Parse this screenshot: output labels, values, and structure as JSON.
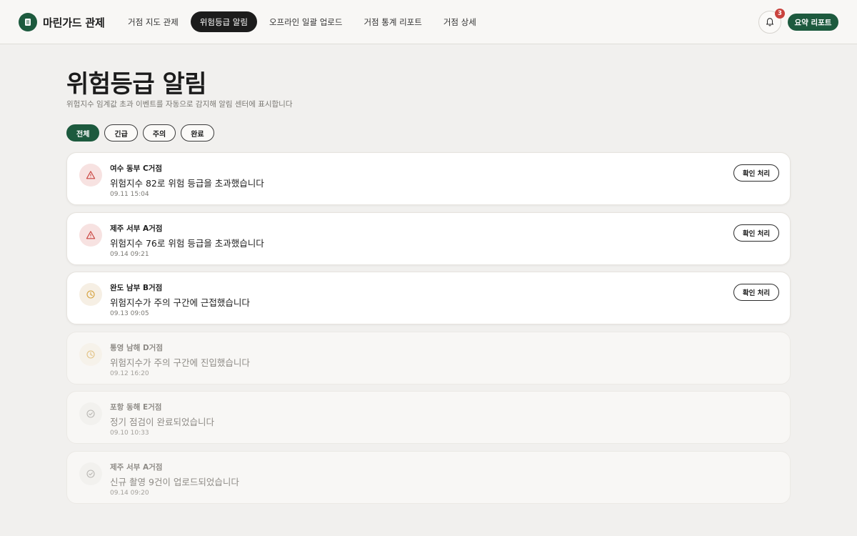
{
  "brand": {
    "name": "마린가드 관제",
    "icon": "document-icon"
  },
  "nav": {
    "tabs": [
      {
        "label": "거점 지도 관제",
        "active": false
      },
      {
        "label": "위험등급 알림",
        "active": true
      },
      {
        "label": "오프라인 일괄 업로드",
        "active": false
      },
      {
        "label": "거점 통계 리포트",
        "active": false
      },
      {
        "label": "거점 상세",
        "active": false
      }
    ]
  },
  "header": {
    "notification_count": "3",
    "report_label": "요약 리포트"
  },
  "page": {
    "title": "위험등급 알림",
    "subtitle": "위험지수 임계값 초과 이벤트를 자동으로 감지해 알림 센터에 표시합니다"
  },
  "filters": [
    {
      "label": "전체",
      "active": true
    },
    {
      "label": "긴급",
      "active": false
    },
    {
      "label": "주의",
      "active": false
    },
    {
      "label": "완료",
      "active": false
    }
  ],
  "alerts": [
    {
      "site": "여수 동부 C거점",
      "message": "위험지수 82로 위험 등급을 초과했습니다",
      "time": "09.11 15:04",
      "level": "danger",
      "icon": "warning-triangle-icon",
      "action": "확인 처리"
    },
    {
      "site": "제주 서부 A거점",
      "message": "위험지수 76로 위험 등급을 초과했습니다",
      "time": "09.14 09:21",
      "level": "danger",
      "icon": "warning-triangle-icon",
      "action": "확인 처리"
    },
    {
      "site": "완도 남부 B거점",
      "message": "위험지수가 주의 구간에 근접했습니다",
      "time": "09.13 09:05",
      "level": "warn",
      "icon": "clock-icon",
      "action": "확인 처리"
    },
    {
      "site": "통영 남해 D거점",
      "message": "위험지수가 주의 구간에 진입했습니다",
      "time": "09.12 16:20",
      "level": "warn-muted",
      "icon": "clock-icon",
      "action": ""
    },
    {
      "site": "포항 동해 E거점",
      "message": "정기 점검이 완료되었습니다",
      "time": "09.10 10:33",
      "level": "done",
      "icon": "check-circle-icon",
      "action": ""
    },
    {
      "site": "제주 서부 A거점",
      "message": "신규 촬영 9건이 업로드되었습니다",
      "time": "09.14 09:20",
      "level": "done",
      "icon": "check-circle-icon",
      "action": ""
    }
  ],
  "colors": {
    "brand": "#1d5a3e",
    "danger": "#c9433e",
    "warn": "#d4a03a",
    "done": "#8e8b86"
  }
}
